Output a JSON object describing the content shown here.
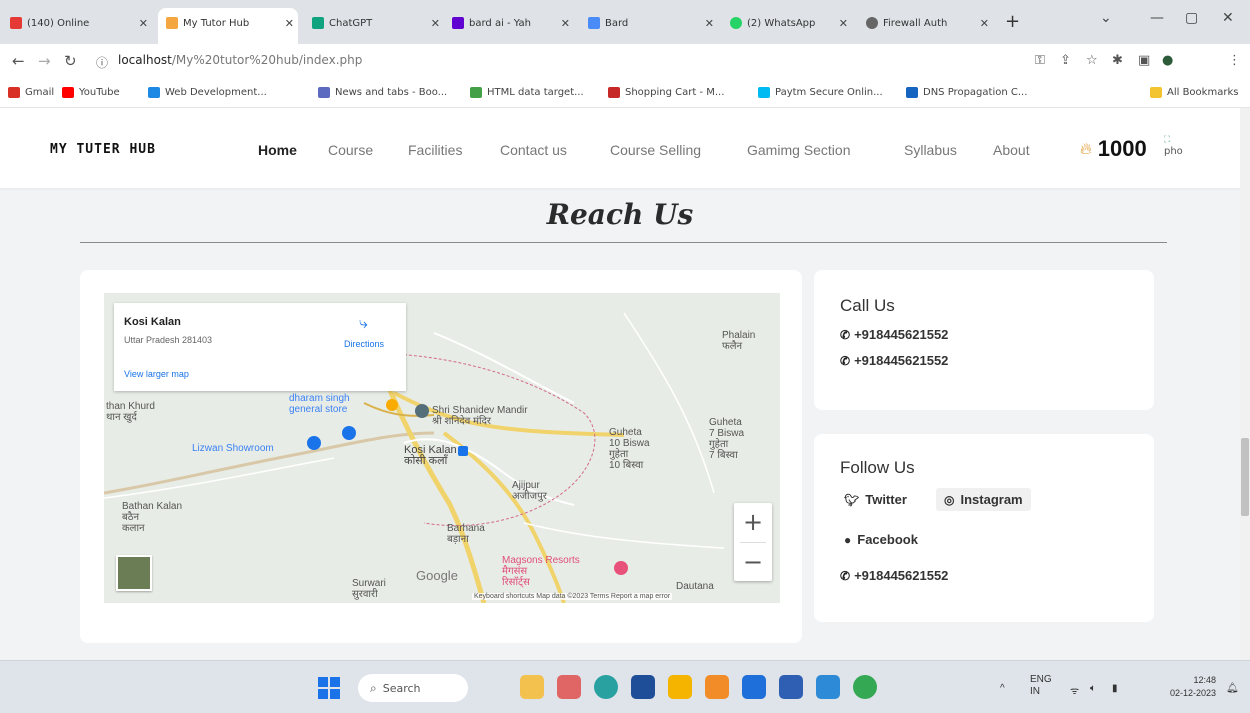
{
  "browser": {
    "tabs": [
      {
        "title": "(140) Online",
        "color": "#e53935"
      },
      {
        "title": "My Tutor Hub",
        "color": "#f4a640",
        "active": true
      },
      {
        "title": "ChatGPT",
        "color": "#10a37f"
      },
      {
        "title": "bard ai - Yah",
        "color": "#6001d2"
      },
      {
        "title": "Bard",
        "color": "#4a8cf7"
      },
      {
        "title": "(2) WhatsApp",
        "color": "#25d366"
      },
      {
        "title": "Firewall Auth",
        "color": "#666666"
      }
    ],
    "url_host": "localhost",
    "url_path": "/My%20tutor%20hub/index.php",
    "bookmarks": [
      {
        "label": "Gmail",
        "color": "#d93025"
      },
      {
        "label": "YouTube",
        "color": "#ff0000"
      },
      {
        "label": "Web Development...",
        "color": "#1e88e5"
      },
      {
        "label": "News and tabs - Boo...",
        "color": "#5c6bc0"
      },
      {
        "label": "HTML data target...",
        "color": "#43a047"
      },
      {
        "label": "Shopping Cart - M...",
        "color": "#c62828"
      },
      {
        "label": "Paytm Secure Onlin...",
        "color": "#00baf2"
      },
      {
        "label": "DNS Propagation C...",
        "color": "#1565c0"
      }
    ],
    "all_bookmarks": "All Bookmarks"
  },
  "site": {
    "logo": "MY TUTER HUB",
    "nav": [
      "Home",
      "Course",
      "Facilities",
      "Contact us",
      "Course Selling",
      "Gamimg Section",
      "Syllabus",
      "About"
    ],
    "coins": "1000",
    "avatar_alt": "pho"
  },
  "section_title": "Reach Us",
  "map": {
    "place_name": "Kosi Kalan",
    "address": "Uttar Pradesh 281403",
    "directions": "Directions",
    "larger_map": "View larger map",
    "google": "Google",
    "attribution": "Keyboard shortcuts   Map data ©2023   Terms   Report a map error",
    "zoom_in": "+",
    "zoom_out": "−",
    "labels": {
      "phalain": "Phalain",
      "phalain_hi": "फलैन",
      "than_khurd": "than Khurd",
      "than_khurd_hi": "थान खुर्द",
      "dharam_singh": "dharam singh",
      "general_store": "general store",
      "shri_shanidev": "Shri Shanidev Mandir",
      "shri_shanidev_hi": "श्री शनिदेव मंदिर",
      "guheta_7": "Guheta",
      "guheta_7b": "7 Biswa",
      "guheta_7_hi": "गुहेता",
      "guheta_7_hib": "7 बिस्वा",
      "guheta_10": "Guheta",
      "guheta_10b": "10 Biswa",
      "guheta_10_hi": "गुहेता",
      "guheta_10_hib": "10 बिस्वा",
      "lizwan": "Lizwan Showroom",
      "kosi_kalan": "Kosi Kalan",
      "kosi_kalan_hi": "कोसी कलाँ",
      "ajijpur": "Ajijpur",
      "ajijpur_hi": "अजीजपुर",
      "bathan": "Bathan Kalan",
      "bathan_hi": "बठैन",
      "bathan_hi2": "कलान",
      "barhana": "Barhana",
      "barhana_hi": "बड़ाना",
      "magsons": "Magsons Resorts",
      "magsons_hi": "मैगसंस",
      "magsons_hi2": "रिसॉर्ट्स",
      "surwari": "Surwari",
      "surwari_hi": "सुरवारी",
      "dautana": "Dautana"
    }
  },
  "call_us": {
    "title": "Call Us",
    "phones": [
      "+918445621552",
      "+918445621552"
    ]
  },
  "follow_us": {
    "title": "Follow Us",
    "twitter": "Twitter",
    "instagram": "Instagram",
    "facebook": "Facebook",
    "phone": "+918445621552"
  },
  "taskbar": {
    "search": "Search",
    "lang": "ENG",
    "region": "IN",
    "time": "12:48",
    "date": "02-12-2023"
  }
}
